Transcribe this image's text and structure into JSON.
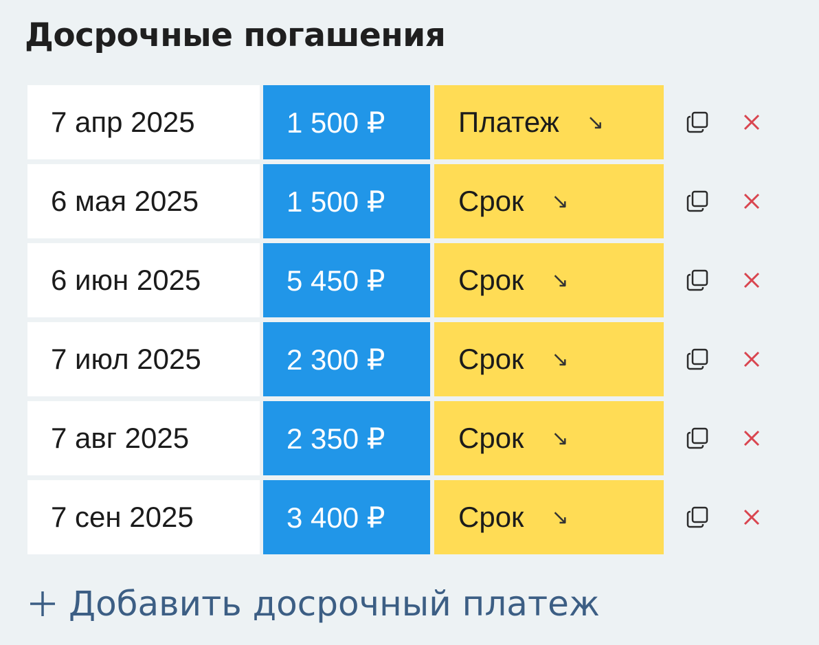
{
  "title": "Досрочные погашения",
  "payments": [
    {
      "date": "7 апр 2025",
      "amount": "1 500 ₽",
      "type": "Платеж",
      "arrow": "↘"
    },
    {
      "date": "6 мая 2025",
      "amount": "1 500 ₽",
      "type": "Срок",
      "arrow": "↘"
    },
    {
      "date": "6 июн 2025",
      "amount": "5 450 ₽",
      "type": "Срок",
      "arrow": "↘"
    },
    {
      "date": "7 июл 2025",
      "amount": "2 300 ₽",
      "type": "Срок",
      "arrow": "↘"
    },
    {
      "date": "7 авг 2025",
      "amount": "2 350 ₽",
      "type": "Срок",
      "arrow": "↘"
    },
    {
      "date": "7 сен 2025",
      "amount": "3 400 ₽",
      "type": "Срок",
      "arrow": "↘"
    }
  ],
  "icons": {
    "copy": "copy-icon",
    "delete": "close-icon",
    "add": "plus-icon"
  },
  "add_label": "Добавить досрочный платеж",
  "colors": {
    "background": "#edf2f4",
    "amount_bg": "#2196e8",
    "type_bg": "#ffdc55",
    "delete": "#d9454f",
    "link": "#3c5e84"
  }
}
